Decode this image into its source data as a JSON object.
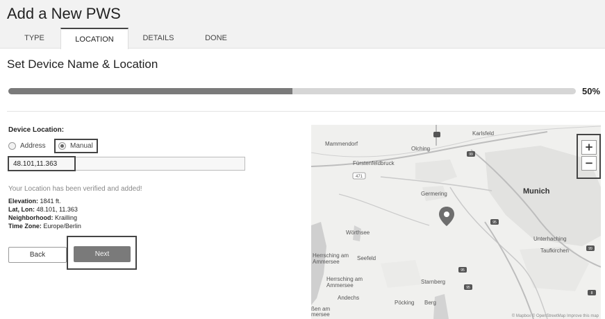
{
  "header": {
    "title": "Add a New PWS",
    "tabs": [
      {
        "label": "TYPE"
      },
      {
        "label": "LOCATION"
      },
      {
        "label": "DETAILS"
      },
      {
        "label": "DONE"
      }
    ],
    "active_tab": "LOCATION"
  },
  "section": {
    "title": "Set Device Name & Location"
  },
  "progress": {
    "value": 0.5,
    "label": "50%"
  },
  "form": {
    "location_label": "Device Location:",
    "radio_address": "Address",
    "radio_manual": "Manual",
    "selected_option": "Manual",
    "coordinates_value": "48.101,11.363",
    "verified_message": "Your Location has been verified and added!",
    "elevation_label": "Elevation:",
    "elevation_value": "1841 ft.",
    "latlon_label": "Lat, Lon:",
    "latlon_value": "48.101, 11.363",
    "neighborhood_label": "Neighborhood:",
    "neighborhood_value": "Krailling",
    "timezone_label": "Time Zone:",
    "timezone_value": "Europe/Berlin"
  },
  "buttons": {
    "back": "Back",
    "next": "Next"
  },
  "map": {
    "zoom_in": "+",
    "zoom_out": "−",
    "attribution": "© Mapbox © OpenStreetMap Improve this map",
    "labels": {
      "mammendorf": "Mammendorf",
      "olching": "Olching",
      "karlsfeld": "Karlsfeld",
      "fuerstenfeldbruck": "Fürstenfeldbruck",
      "germering": "Germering",
      "munich": "Munich",
      "woerthsee": "Wörthsee",
      "herrsching_am": "Herrsching am",
      "ammersee_1": "Ammersee",
      "seefeld": "Seefeld",
      "unterhaching": "Unterhaching",
      "taufkirchen": "Taufkirchen",
      "herrsching_am_2": "Herrsching am",
      "ammersee_2": "Ammersee",
      "starnberg": "Starnberg",
      "andechs": "Andechs",
      "poecking": "Pöcking",
      "berg": "Berg",
      "dießen_am": "ßen am",
      "ammersee_3": "mersee"
    },
    "road_shields": [
      "471",
      "99",
      "95",
      "99",
      "95",
      "95",
      "8"
    ]
  }
}
